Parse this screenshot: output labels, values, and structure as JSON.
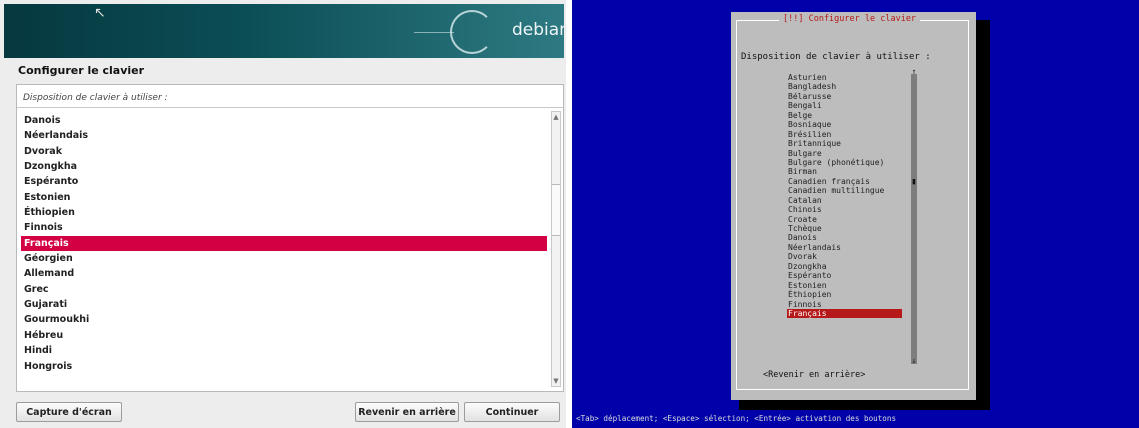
{
  "gui": {
    "brand": "debian",
    "title": "Configurer le clavier",
    "prompt": "Disposition de clavier à utiliser :",
    "items": [
      {
        "label": "Danois"
      },
      {
        "label": "Néerlandais"
      },
      {
        "label": "Dvorak"
      },
      {
        "label": "Dzongkha"
      },
      {
        "label": "Espéranto"
      },
      {
        "label": "Estonien"
      },
      {
        "label": "Éthiopien"
      },
      {
        "label": "Finnois"
      },
      {
        "label": "Français"
      },
      {
        "label": "Géorgien"
      },
      {
        "label": "Allemand"
      },
      {
        "label": "Grec"
      },
      {
        "label": "Gujarati"
      },
      {
        "label": "Gourmoukhi"
      },
      {
        "label": "Hébreu"
      },
      {
        "label": "Hindi"
      },
      {
        "label": "Hongrois"
      }
    ],
    "selected": "Français",
    "buttons": {
      "screenshot": "Capture d'écran",
      "back": "Revenir en arrière",
      "continue": "Continuer"
    }
  },
  "tui": {
    "title": "[!!] Configurer le clavier",
    "prompt": "Disposition de clavier à utiliser :",
    "items": [
      {
        "label": "Asturien"
      },
      {
        "label": "Bangladesh"
      },
      {
        "label": "Bélarusse"
      },
      {
        "label": "Bengali"
      },
      {
        "label": "Belge"
      },
      {
        "label": "Bosniaque"
      },
      {
        "label": "Brésilien"
      },
      {
        "label": "Britannique"
      },
      {
        "label": "Bulgare"
      },
      {
        "label": "Bulgare (phonétique)"
      },
      {
        "label": "Birman"
      },
      {
        "label": "Canadien français"
      },
      {
        "label": "Canadien multilingue"
      },
      {
        "label": "Catalan"
      },
      {
        "label": "Chinois"
      },
      {
        "label": "Croate"
      },
      {
        "label": "Tchèque"
      },
      {
        "label": "Danois"
      },
      {
        "label": "Néerlandais"
      },
      {
        "label": "Dvorak"
      },
      {
        "label": "Dzongkha"
      },
      {
        "label": "Espéranto"
      },
      {
        "label": "Estonien"
      },
      {
        "label": "Éthiopien"
      },
      {
        "label": "Finnois"
      },
      {
        "label": "Français"
      }
    ],
    "selected": "Français",
    "back_label": "<Revenir en arrière>",
    "status": "<Tab> déplacement; <Espace> sélection; <Entrée> activation des boutons"
  },
  "colors": {
    "gui_selection": "#d30044",
    "tui_background": "#0101aa",
    "tui_selection": "#b51919"
  },
  "icons": {
    "cursor": "mouse-pointer-icon",
    "logo": "debian-swirl-icon",
    "scroll_up": "arrow-up-icon",
    "scroll_down": "arrow-down-icon"
  }
}
